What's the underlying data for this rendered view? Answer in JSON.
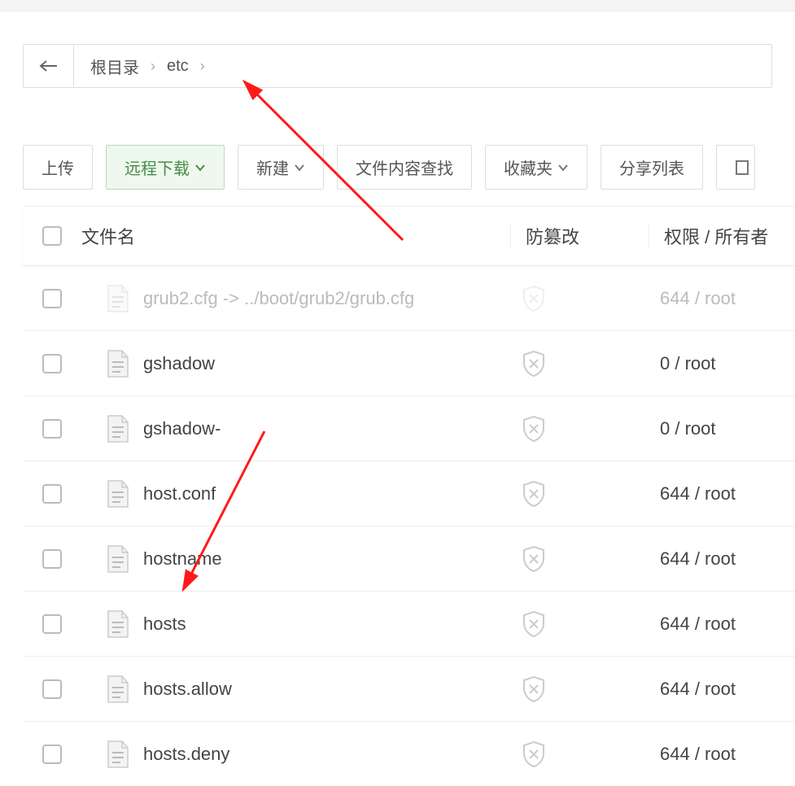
{
  "breadcrumb": {
    "root": "根目录",
    "items": [
      "etc"
    ]
  },
  "toolbar": {
    "upload": "上传",
    "remote_download": "远程下载",
    "new": "新建",
    "content_search": "文件内容查找",
    "favorites": "收藏夹",
    "share_list": "分享列表"
  },
  "table": {
    "headers": {
      "name": "文件名",
      "tamper": "防篡改",
      "perm": "权限 / 所有者"
    },
    "rows": [
      {
        "name": "grub2.cfg -> ../boot/grub2/grub.cfg",
        "perm": "644 / root",
        "faded": true
      },
      {
        "name": "gshadow",
        "perm": "0 / root"
      },
      {
        "name": "gshadow-",
        "perm": "0 / root"
      },
      {
        "name": "host.conf",
        "perm": "644 / root"
      },
      {
        "name": "hostname",
        "perm": "644 / root"
      },
      {
        "name": "hosts",
        "perm": "644 / root"
      },
      {
        "name": "hosts.allow",
        "perm": "644 / root"
      },
      {
        "name": "hosts.deny",
        "perm": "644 / root"
      }
    ]
  }
}
